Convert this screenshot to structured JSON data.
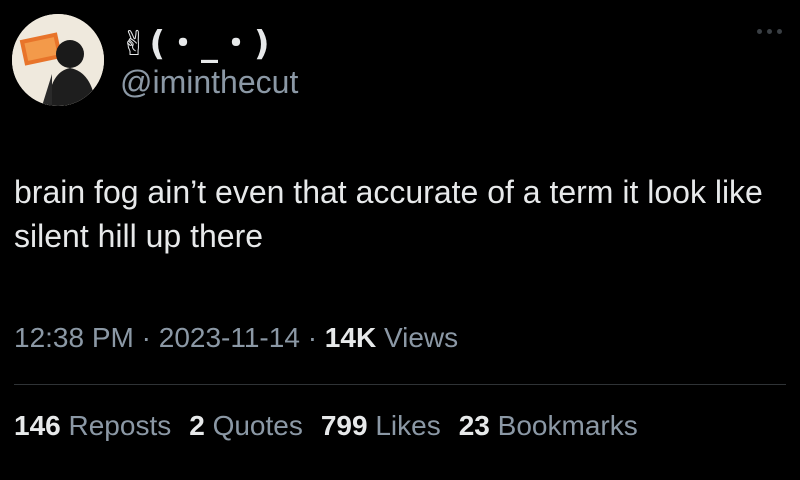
{
  "tweet": {
    "display_name": "✌(・_・)",
    "handle": "@iminthecut",
    "text": "brain fog ain’t even that accurate of a term it look like silent hill up there",
    "time": "12:38 PM",
    "separator": "·",
    "date": "2023-11-14",
    "views_count": "14K",
    "views_label": "Views"
  },
  "stats": [
    {
      "count": "146",
      "label": "Reposts"
    },
    {
      "count": "2",
      "label": "Quotes"
    },
    {
      "count": "799",
      "label": "Likes"
    },
    {
      "count": "23",
      "label": "Bookmarks"
    }
  ],
  "icons": {
    "more": "more-horizontal-icon"
  },
  "colors": {
    "background": "#000000",
    "primary_text": "#e7e9ea",
    "secondary_text": "#8b98a5",
    "divider": "#2f3336"
  }
}
